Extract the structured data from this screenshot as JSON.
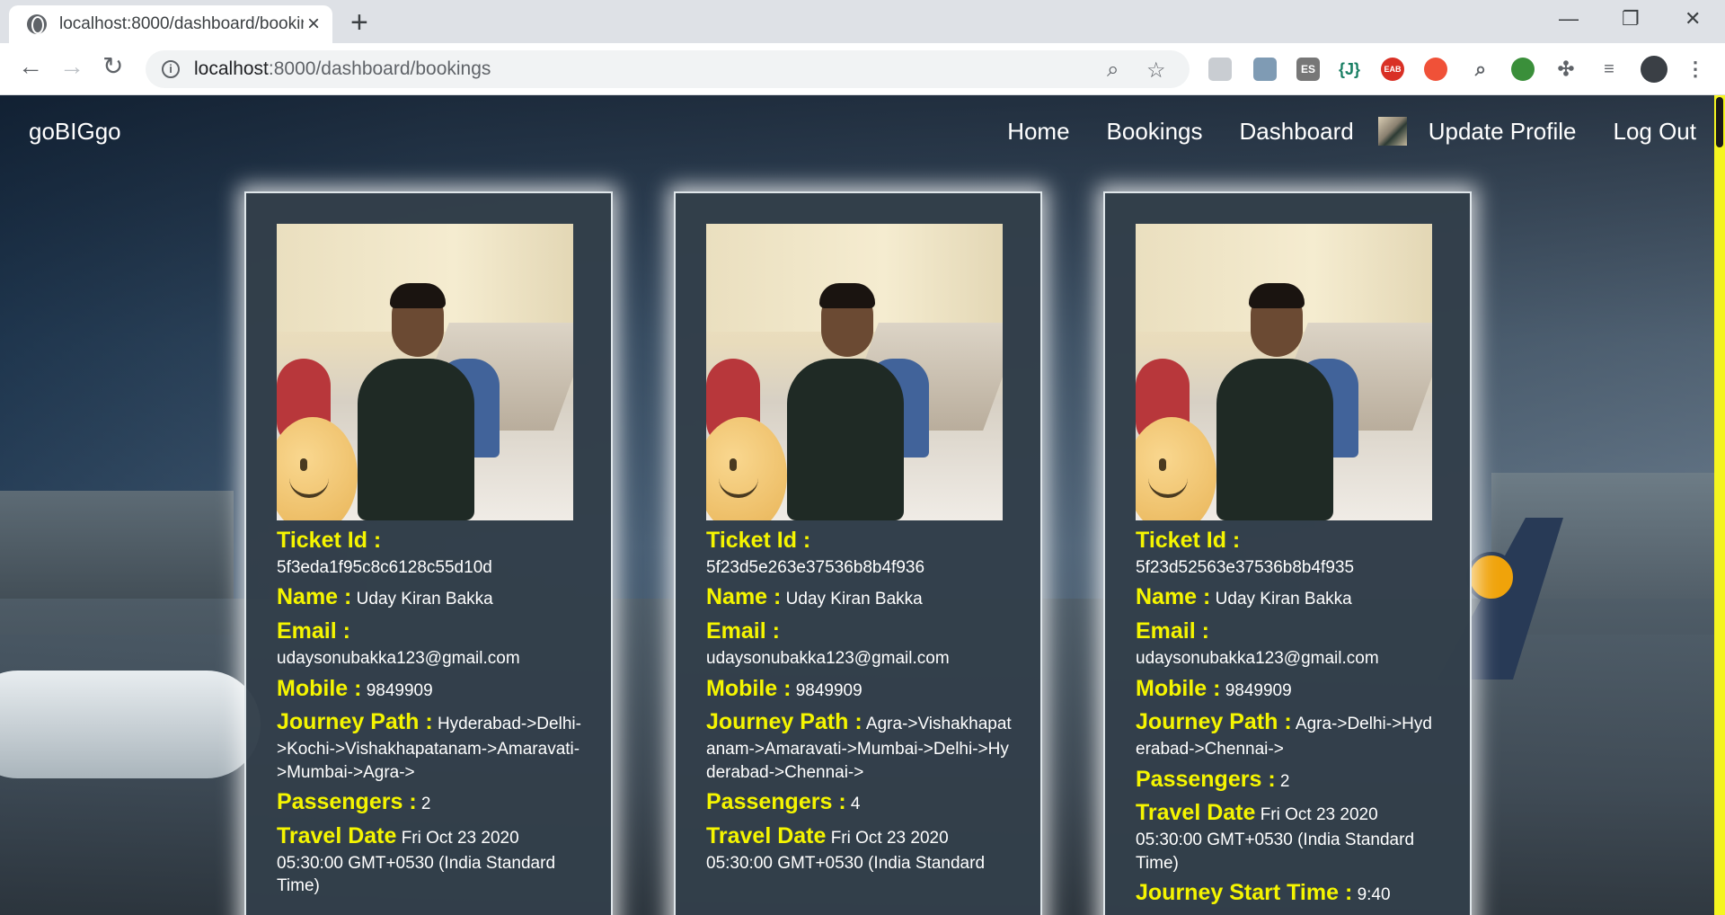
{
  "browser": {
    "tab_title": "localhost:8000/dashboard/bookings",
    "url_host": "localhost",
    "url_path": ":8000/dashboard/bookings",
    "extensions": [
      "ES",
      "{J}",
      "EAB"
    ]
  },
  "navbar": {
    "brand": "goBIGgo",
    "links": {
      "home": "Home",
      "bookings": "Bookings",
      "dashboard": "Dashboard",
      "update_profile": "Update Profile",
      "logout": "Log Out"
    }
  },
  "labels": {
    "ticket_id": "Ticket Id :",
    "name": "Name :",
    "email": "Email :",
    "mobile": "Mobile :",
    "journey_path": "Journey Path :",
    "passengers": "Passengers :",
    "travel_date": "Travel Date",
    "journey_start": "Journey Start Time :"
  },
  "bookings": [
    {
      "ticket_id": "5f3eda1f95c8c6128c55d10d",
      "name": "Uday Kiran Bakka",
      "email": "udaysonubakka123@gmail.com",
      "mobile": "9849909",
      "journey_path": "Hyderabad->Delhi->Kochi->Vishakhapatanam->Amaravati->Mumbai->Agra->",
      "passengers": "2",
      "travel_date": "Fri Oct 23 2020 05:30:00 GMT+0530 (India Standard Time)"
    },
    {
      "ticket_id": "5f23d5e263e37536b8b4f936",
      "name": "Uday Kiran Bakka",
      "email": "udaysonubakka123@gmail.com",
      "mobile": "9849909",
      "journey_path": "Agra->Vishakhapatanam->Amaravati->Mumbai->Delhi->Hyderabad->Chennai->",
      "passengers": "4",
      "travel_date": "Fri Oct 23 2020 05:30:00 GMT+0530 (India Standard"
    },
    {
      "ticket_id": "5f23d52563e37536b8b4f935",
      "name": "Uday Kiran Bakka",
      "email": "udaysonubakka123@gmail.com",
      "mobile": "9849909",
      "journey_path": "Agra->Delhi->Hyderabad->Chennai->",
      "passengers": "2",
      "travel_date": "Fri Oct 23 2020 05:30:00 GMT+0530 (India Standard Time)",
      "journey_start": "9:40"
    }
  ],
  "colors": {
    "label_yellow": "#f5f500",
    "card_bg": "#333f4a",
    "scrollbar_track": "#f5f520"
  }
}
